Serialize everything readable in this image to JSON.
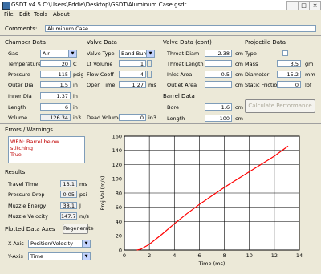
{
  "window": {
    "title": "GSDT v4.5   C:\\Users\\Eddie\\Desktop\\GSDT\\Aluminum Case.gsdt"
  },
  "menu": [
    "File",
    "Edit",
    "Tools",
    "About"
  ],
  "comments": {
    "label": "Comments:",
    "value": "Aluminum Case"
  },
  "chamber": {
    "header": "Chamber Data",
    "gas_label": "Gas",
    "gas_value": "Air",
    "temperature_label": "Temperature",
    "temperature_value": "20",
    "temperature_unit": "C",
    "pressure_label": "Pressure",
    "pressure_value": "115",
    "pressure_unit": "psig",
    "outer_dia_label": "Outer Dia",
    "outer_dia_value": "1.5",
    "outer_dia_unit": "in",
    "inner_dia_label": "Inner Dia",
    "inner_dia_value": "1.37",
    "inner_dia_unit": "in",
    "length_label": "Length",
    "length_value": "6",
    "length_unit": "in",
    "volume_label": "Volume",
    "volume_value": "126.34",
    "volume_unit": "in3"
  },
  "valve": {
    "header": "Valve Data",
    "type_label": "Valve Type",
    "type_value": "Band Burst",
    "volume_label": "Lt Volume",
    "volume_value": "1",
    "flow_label": "Flow Coeff",
    "flow_value": "4",
    "open_label": "Open Time",
    "open_value": "1.27",
    "open_unit": "ms",
    "dead_label": "Dead Volume",
    "dead_value": "0",
    "dead_unit": "in3"
  },
  "valve_cont": {
    "header": "Valve Data (cont)",
    "rows": [
      {
        "label": "Throat Diam",
        "value": "2.38",
        "unit": "cm"
      },
      {
        "label": "Throat Length",
        "value": "",
        "unit": "cm"
      },
      {
        "label": "Inlet Area",
        "value": "0.5",
        "unit": "cm"
      },
      {
        "label": "Outlet Area",
        "value": "",
        "unit": "cm"
      }
    ]
  },
  "barrel": {
    "header": "Barrel Data",
    "bore_label": "Bore",
    "bore_value": "1.6",
    "bore_unit": "cm",
    "length_label": "Length",
    "length_value": "100",
    "length_unit": "cm"
  },
  "projectile": {
    "header": "Projectile Data",
    "rows": [
      {
        "label": "Type",
        "value": "",
        "unit": ""
      },
      {
        "label": "Mass",
        "value": "3.5",
        "unit": "gm"
      },
      {
        "label": "Diameter",
        "value": "15.2",
        "unit": "mm"
      },
      {
        "label": "Static Friction",
        "value": "0",
        "unit": "lbf"
      }
    ],
    "calc_button": "Calculate Performance"
  },
  "errors": {
    "header": "Errors / Warnings",
    "text": "WRN: Barrel below stitching\nTrue"
  },
  "results": {
    "header": "Results",
    "rows": [
      {
        "label": "Travel Time",
        "value": "13.1",
        "unit": "ms"
      },
      {
        "label": "Pressure Drop",
        "value": "0.05",
        "unit": "psi"
      },
      {
        "label": "Muzzle Energy",
        "value": "38.1",
        "unit": "J"
      },
      {
        "label": "Muzzle Velocity",
        "value": "147.7",
        "unit": "m/s"
      }
    ]
  },
  "plotted": {
    "header": "Plotted Data Axes",
    "regen_button": "Regenerate",
    "xaxis_label": "X-Axis",
    "xaxis_value": "Position/Velocity",
    "yaxis_label": "Y-Axis",
    "yaxis_value": "Time"
  },
  "chart_data": {
    "type": "line",
    "xlabel": "Time (ms)",
    "ylabel": "Proj Vel (m/s)",
    "xlim": [
      0,
      14
    ],
    "ylim": [
      0,
      160
    ],
    "xticks": [
      0,
      2,
      4,
      6,
      8,
      10,
      12,
      14
    ],
    "yticks": [
      0,
      20,
      40,
      60,
      80,
      100,
      120,
      140,
      160
    ],
    "grid": true,
    "series": [
      {
        "color": "#ff0000",
        "x": [
          1.0,
          1.3,
          2,
          3,
          4,
          5,
          6,
          7,
          8,
          9,
          10,
          11,
          12,
          13.1
        ],
        "y": [
          0,
          1,
          8,
          22,
          37,
          51,
          64,
          76,
          88,
          99,
          110,
          121,
          132,
          146
        ]
      }
    ]
  }
}
